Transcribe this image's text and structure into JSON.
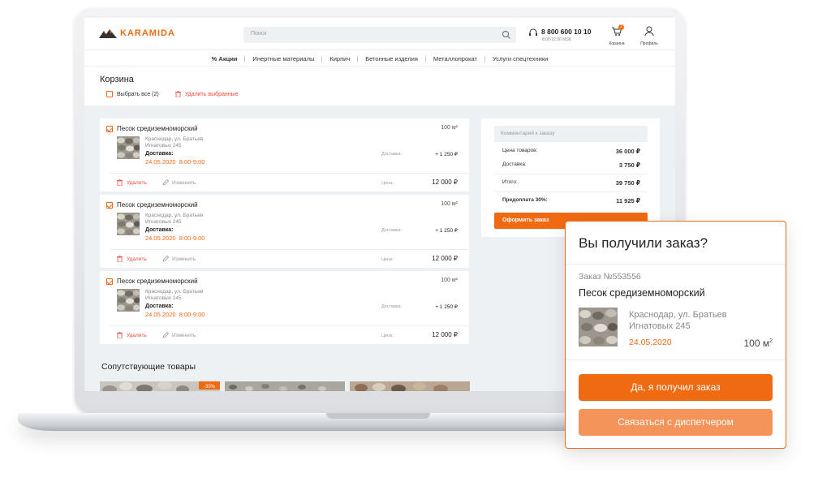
{
  "header": {
    "brand": "KARAMIDA",
    "search_placeholder": "Поиск",
    "phone": "8 800 600 10 10",
    "hours": "8:00-22:00 MSK",
    "cart_count": "2",
    "cart_label": "Корзина",
    "profile_label": "Профиль"
  },
  "nav": [
    "% Акции",
    "Инертные материалы",
    "Кирпич",
    "Бетонные изделия",
    "Металлопрокат",
    "Услуги спецтехники"
  ],
  "page": {
    "title": "Корзина",
    "select_all": "Выбрать все (2)",
    "delete_selected": "Удалить выбранные"
  },
  "items": [
    {
      "name": "Песок средиземноморский",
      "qty": "100 м²",
      "addr1": "Краснодар, ул. Братьев",
      "addr2": "Игнатовых 245",
      "delivery_label": "Доставка:",
      "date": "24.05.2020",
      "time": "8:00-9:00",
      "delivery_caption": "Доставка:",
      "delivery_price": "+ 1 250 ₽",
      "delete": "Удалить",
      "edit": "Изменить",
      "price_caption": "Цена:",
      "price": "12 000 ₽"
    },
    {
      "name": "Песок средиземноморский",
      "qty": "100 м²",
      "addr1": "Краснодар, ул. Братьев",
      "addr2": "Игнатовых 245",
      "delivery_label": "Доставка:",
      "date": "24.05.2020",
      "time": "8:00-9:00",
      "delivery_caption": "Доставка:",
      "delivery_price": "+ 1 250 ₽",
      "delete": "Удалить",
      "edit": "Изменить",
      "price_caption": "Цена:",
      "price": "12 000 ₽"
    },
    {
      "name": "Песок средиземноморский",
      "qty": "100 м²",
      "addr1": "Краснодар, ул. Братьев",
      "addr2": "Игнатовых 245",
      "delivery_label": "Доставка:",
      "date": "24.05.2020",
      "time": "8:00-9:00",
      "delivery_caption": "Доставка:",
      "delivery_price": "+ 1 250 ₽",
      "delete": "Удалить",
      "edit": "Изменить",
      "price_caption": "Цена:",
      "price": "12 000 ₽"
    }
  ],
  "summary": {
    "comment_placeholder": "Комментарий к заказу",
    "goods_label": "Цена товаров:",
    "goods_value": "36 000 ₽",
    "delivery_label": "Доставка:",
    "delivery_value": "3 750 ₽",
    "total_label": "Итого:",
    "total_value": "39 750 ₽",
    "prepay_label": "Предоплата 30%:",
    "prepay_value": "11 925 ₽",
    "order_button": "Оформить заказ"
  },
  "related": {
    "title": "Сопутствующие товары",
    "badge": "-30%"
  },
  "popup": {
    "title": "Вы получили заказ?",
    "order_no": "Заказ №553556",
    "product": "Песок средиземноморский",
    "addr1": "Краснодар, ул. Братьев",
    "addr2": "Игнатовых 245",
    "date": "24.05.2020",
    "qty": "100 м",
    "qty_sup": "2",
    "confirm_button": "Да, я получил заказ",
    "contact_button": "Связаться с диспетчером"
  },
  "colors": {
    "accent": "#f06a12",
    "danger": "#e84b3a",
    "bg_gray": "#eef1f4"
  }
}
